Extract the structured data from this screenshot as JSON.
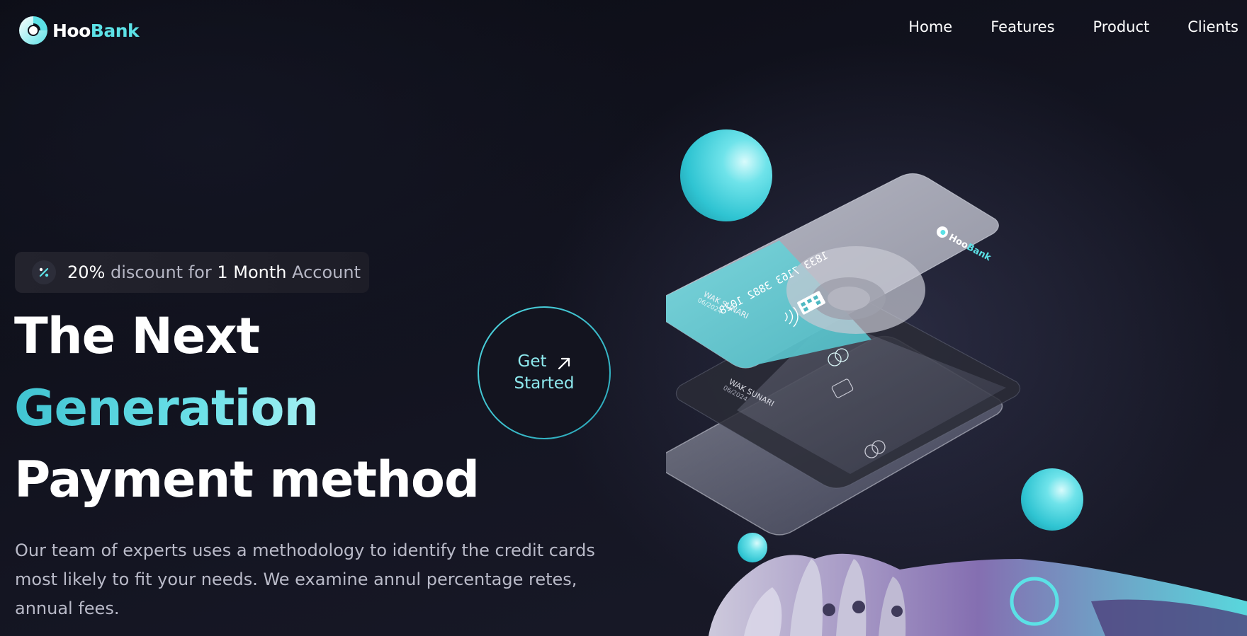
{
  "brand": {
    "name_part1": "Hoo",
    "name_part2": "Bank",
    "accent_color": "#5ce1e6"
  },
  "nav": {
    "items": [
      {
        "label": "Home"
      },
      {
        "label": "Features"
      },
      {
        "label": "Product"
      },
      {
        "label": "Clients"
      }
    ]
  },
  "hero": {
    "badge": {
      "icon": "discount-icon",
      "percent": "20%",
      "text1": " discount for ",
      "highlight": "1 Month",
      "text2": " Account"
    },
    "title_line1": "The Next",
    "title_line2": "Generation",
    "title_line3": "Payment method",
    "description": "Our team of experts uses a methodology to identify the credit cards most likely to fit your needs. We examine annul percentage retes, annual fees.",
    "cta": {
      "line1": "Get",
      "line2": "Started",
      "icon": "arrow-up-right-icon"
    }
  },
  "illustration": {
    "card_number": "1833 7163 3882 1028",
    "card_brand_part1": "Hoo",
    "card_brand_part2": "Bank",
    "card_holder": "WAK SUNARI",
    "card_expiry": "06/2024"
  }
}
